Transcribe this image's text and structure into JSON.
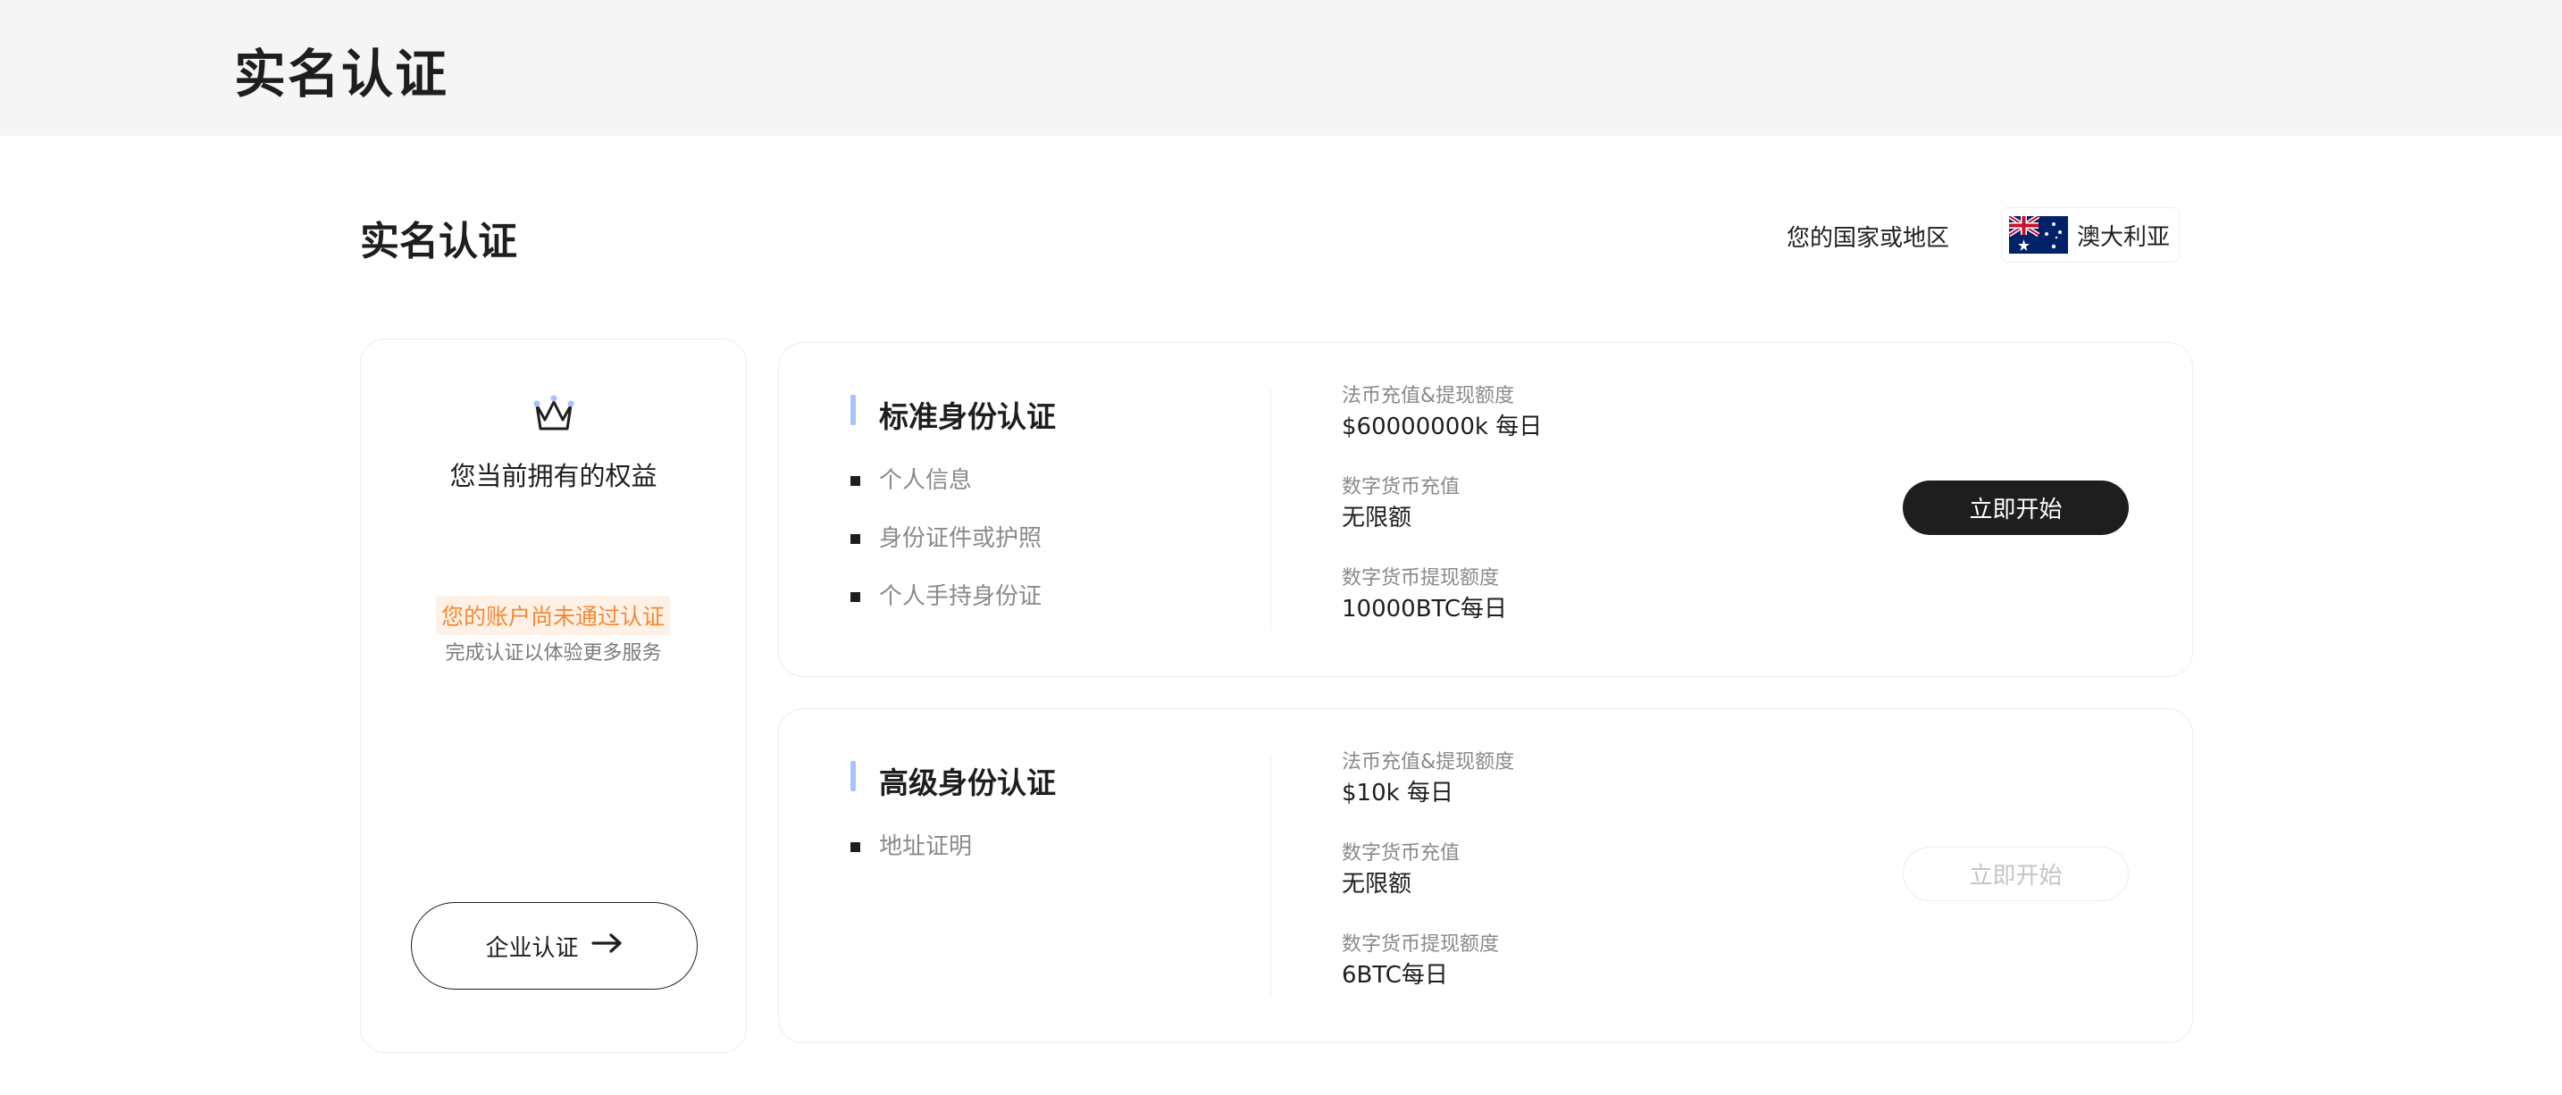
{
  "header": {
    "title": "实名认证"
  },
  "section": {
    "title": "实名认证",
    "region_label": "您的国家或地区",
    "region_value": "澳大利亚",
    "region_flag_icon": "australia-flag-icon"
  },
  "benefits": {
    "icon": "crown-icon",
    "title": "您当前拥有的权益",
    "warning": "您的账户尚未通过认证",
    "warning_sub": "完成认证以体验更多服务",
    "enterprise_button": "企业认证",
    "enterprise_icon": "arrow-right-icon",
    "colors": {
      "warning_text": "#f08a34",
      "warning_bg": "#fff1e6"
    }
  },
  "standard": {
    "title": "标准身份认证",
    "requirements": [
      "个人信息",
      "身份证件或护照",
      "个人手持身份证"
    ],
    "limits": [
      {
        "label": "法币充值&提现额度",
        "value": "$60000000k 每日"
      },
      {
        "label": "数字货币充值",
        "value": "无限额"
      },
      {
        "label": "数字货币提现额度",
        "value": "10000BTC每日"
      }
    ],
    "button": "立即开始"
  },
  "advanced": {
    "title": "高级身份认证",
    "requirements": [
      "地址证明"
    ],
    "limits": [
      {
        "label": "法币充值&提现额度",
        "value": "$10k 每日"
      },
      {
        "label": "数字货币充值",
        "value": "无限额"
      },
      {
        "label": "数字货币提现额度",
        "value": "6BTC每日"
      }
    ],
    "button": "立即开始"
  },
  "colors": {
    "accent_bar": "#a8c1ff",
    "primary_button": "#1e1e1e"
  }
}
